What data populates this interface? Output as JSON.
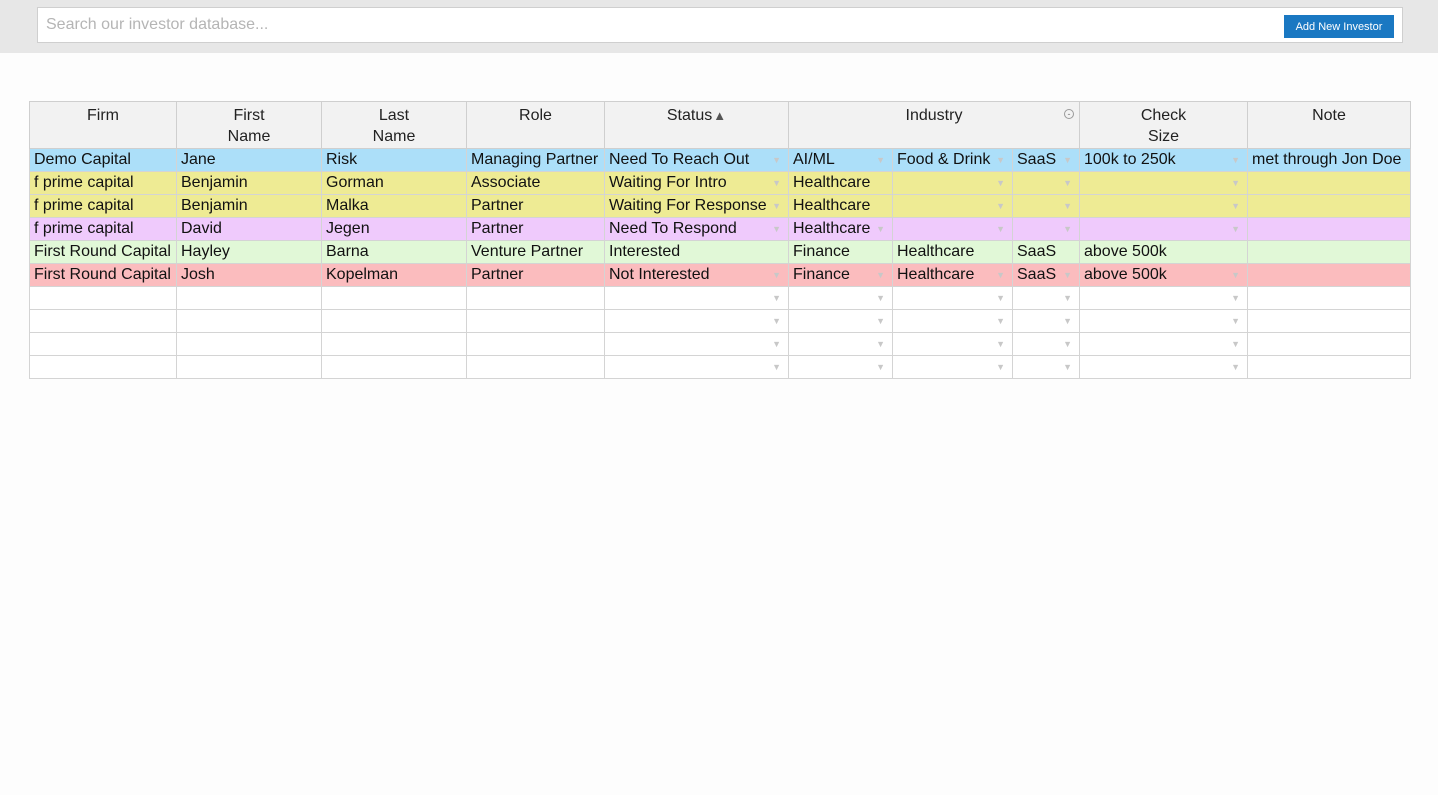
{
  "search": {
    "placeholder": "Search our investor database..."
  },
  "toolbar": {
    "add_label": "Add New Investor"
  },
  "table": {
    "headers": {
      "firm": "Firm",
      "first_name_1": "First",
      "first_name_2": "Name",
      "last_name_1": "Last",
      "last_name_2": "Name",
      "role": "Role",
      "status": "Status",
      "status_sort": "▲",
      "industry": "Industry",
      "check_size_1": "Check",
      "check_size_2": "Size",
      "note": "Note"
    },
    "rows": [
      {
        "color": "#acdff9",
        "firm": "Demo Capital",
        "first": "Jane",
        "last": "Risk",
        "role": "Managing Partner",
        "status": "Need To Reach Out",
        "ind1": "AI/ML",
        "ind2": "Food & Drink",
        "ind3": "SaaS",
        "check": "100k to 250k",
        "note": "met through Jon Doe"
      },
      {
        "color": "#eeeb94",
        "firm": "f prime capital",
        "first": "Benjamin",
        "last": "Gorman",
        "role": "Associate",
        "status": "Waiting For Intro",
        "ind1": "Healthcare",
        "ind2": "",
        "ind3": "",
        "check": "",
        "note": ""
      },
      {
        "color": "#eeeb94",
        "firm": "f prime capital",
        "first": "Benjamin",
        "last": "Malka",
        "role": "Partner",
        "status": "Waiting For Response",
        "ind1": "Healthcare",
        "ind2": "",
        "ind3": "",
        "check": "",
        "note": ""
      },
      {
        "color": "#efcafc",
        "firm": "f prime capital",
        "first": "David",
        "last": "Jegen",
        "role": "Partner",
        "status": "Need To Respond",
        "ind1": "Healthcare",
        "ind2": "",
        "ind3": "",
        "check": "",
        "note": ""
      },
      {
        "color": "#e1f8d7",
        "firm": "First Round Capital",
        "first": "Hayley",
        "last": "Barna",
        "role": "Venture Partner",
        "status": "Interested",
        "ind1": "Finance",
        "ind2": "Healthcare",
        "ind3": "SaaS",
        "check": "above 500k",
        "note": ""
      },
      {
        "color": "#fbbcbe",
        "firm": "First Round Capital",
        "first": "Josh",
        "last": "Kopelman",
        "role": "Partner",
        "status": "Not Interested",
        "ind1": "Finance",
        "ind2": "Healthcare",
        "ind3": "SaaS",
        "check": "above 500k",
        "note": ""
      }
    ]
  },
  "icons": {
    "dropdown": "▼",
    "collapse": "-"
  }
}
